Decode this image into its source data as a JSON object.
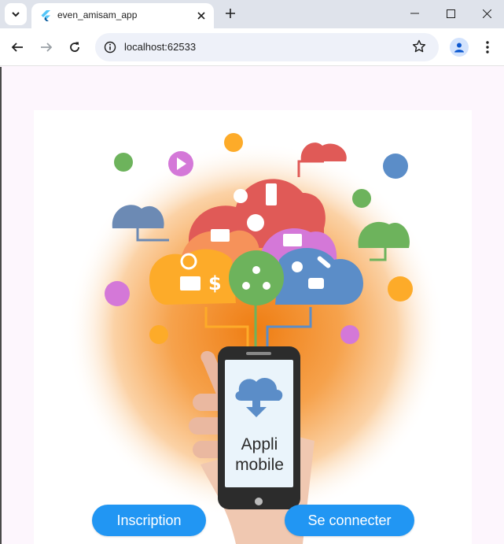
{
  "browser": {
    "tab_title": "even_amisam_app",
    "url": "localhost:62533"
  },
  "phone": {
    "line1": "Appli",
    "line2": "mobile"
  },
  "buttons": {
    "signup_label": "Inscription",
    "login_label": "Se connecter"
  },
  "colors": {
    "button_blue": "#2196f3",
    "cloud_red": "#e05a57",
    "cloud_orange": "#fdab29",
    "cloud_blue": "#5b8dc8",
    "cloud_green": "#6db35c",
    "cloud_purple": "#d478d8",
    "glow_orange": "#f28a1a"
  }
}
